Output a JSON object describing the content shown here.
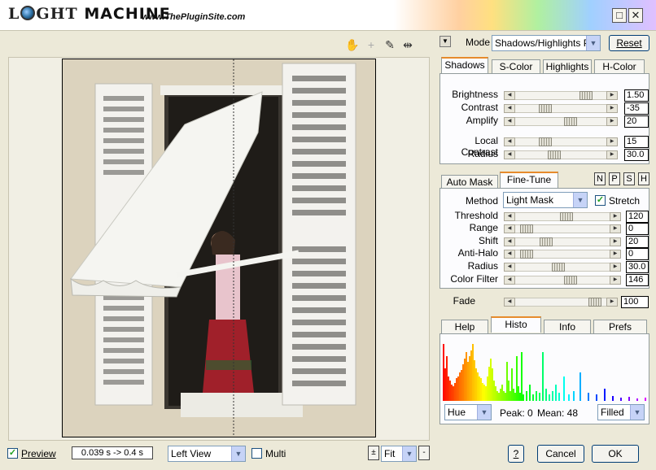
{
  "title": {
    "logo_prefix": "L",
    "logo_suffix": "GHT",
    "logo_main": "MACHINE",
    "site": "www.ThePluginSite.com"
  },
  "header": {
    "mode_label": "Mode",
    "mode_value": "Shadows/Highlights Pro",
    "reset_label": "Reset"
  },
  "top_tabs": [
    "Shadows",
    "S-Color",
    "Highlights",
    "H-Color"
  ],
  "shadows": [
    {
      "label": "Brightness",
      "value": "1.50",
      "pos": 0.83
    },
    {
      "label": "Contrast",
      "value": "-35",
      "pos": 0.3
    },
    {
      "label": "Amplify",
      "value": "20",
      "pos": 0.63
    },
    {
      "label": "Local Contrast",
      "value": "15",
      "pos": 0.3
    },
    {
      "label": "Radius",
      "value": "30.0",
      "pos": 0.42
    }
  ],
  "mask_tabs": [
    "Auto Mask",
    "Fine-Tune"
  ],
  "nsph": [
    "N",
    "P",
    "S",
    "H"
  ],
  "finetune": {
    "method_label": "Method",
    "method_value": "Light Mask",
    "stretch_label": "Stretch",
    "rows": [
      {
        "label": "Threshold",
        "value": "120",
        "pos": 0.55
      },
      {
        "label": "Range",
        "value": "0",
        "pos": 0.05
      },
      {
        "label": "Shift",
        "value": "20",
        "pos": 0.3
      },
      {
        "label": "Anti-Halo",
        "value": "0",
        "pos": 0.05
      },
      {
        "label": "Radius",
        "value": "30.0",
        "pos": 0.45
      },
      {
        "label": "Color Filter",
        "value": "146",
        "pos": 0.6
      }
    ]
  },
  "fade": {
    "label": "Fade",
    "value": "100",
    "pos": 0.95
  },
  "bottom_tabs": [
    "Help",
    "Histo",
    "Info",
    "Prefs"
  ],
  "histo": {
    "channel": "Hue",
    "peak": "Peak: 0",
    "mean": "Mean: 48",
    "style": "Filled"
  },
  "footer": {
    "preview_label": "Preview",
    "timing": "0.039 s -> 0.4 s",
    "view": "Left View",
    "multi_label": "Multi",
    "zoom_plus": "±",
    "zoom_value": "Fit",
    "zoom_minus": "-",
    "help": "?",
    "cancel": "Cancel",
    "ok": "OK"
  }
}
